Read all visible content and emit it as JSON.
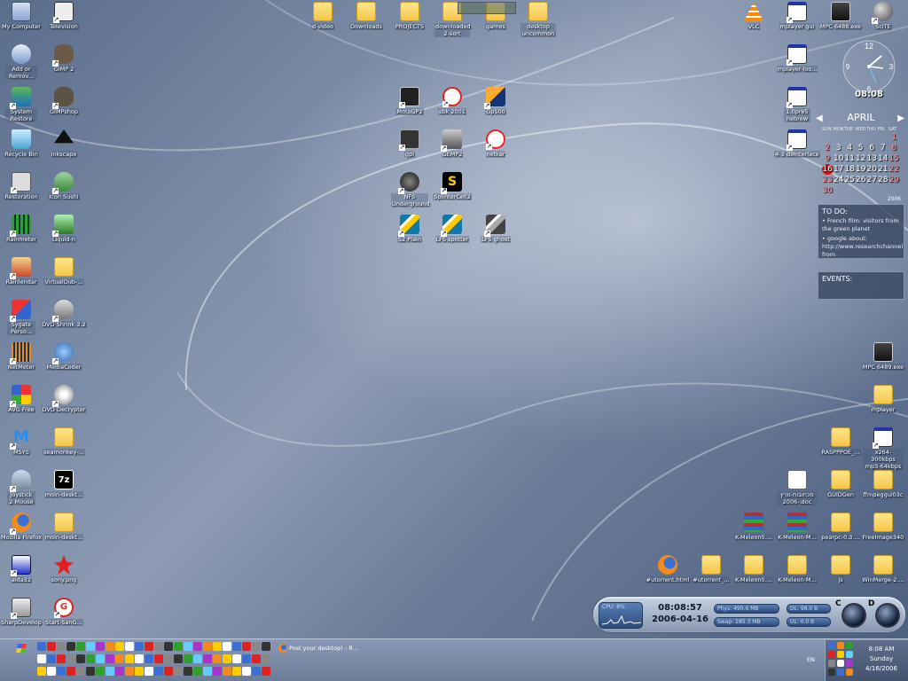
{
  "desktop": {
    "icons": [
      {
        "label": "My Computer",
        "glyph": "computer-icon"
      },
      {
        "label": "Television",
        "glyph": "television-icon"
      },
      {
        "label": "Add or Remov...",
        "glyph": "add-remove-programs-icon"
      },
      {
        "label": "GIMP 2",
        "glyph": "gimp-icon"
      },
      {
        "label": "System Restore",
        "glyph": "system-restore-icon"
      },
      {
        "label": "GIMPshop",
        "glyph": "gimpshop-icon"
      },
      {
        "label": "Recycle Bin",
        "glyph": "recycle-bin-icon"
      },
      {
        "label": "inkscape",
        "glyph": "inkscape-icon"
      },
      {
        "label": "Restoration",
        "glyph": "restoration-icon"
      },
      {
        "label": "Icon Sushi",
        "glyph": "icon-sushi-icon"
      },
      {
        "label": "Rainmeter",
        "glyph": "rainmeter-icon"
      },
      {
        "label": "Liquid-n",
        "glyph": "liquid-n-icon"
      },
      {
        "label": "Rainlendar",
        "glyph": "rainlendar-icon"
      },
      {
        "label": "VirtualDub-...",
        "glyph": "folder-icon"
      },
      {
        "label": "Sygate Perso...",
        "glyph": "sygate-icon"
      },
      {
        "label": "DVD Shrink 3.2",
        "glyph": "dvd-shrink-icon"
      },
      {
        "label": "NetMeter",
        "glyph": "netmeter-icon"
      },
      {
        "label": "MediaCoder",
        "glyph": "mediacoder-icon"
      },
      {
        "label": "AVG Free",
        "glyph": "avg-icon"
      },
      {
        "label": "DVD Decrypter",
        "glyph": "dvd-decrypter-icon"
      },
      {
        "label": "MSYS",
        "glyph": "msys-icon"
      },
      {
        "label": "seamonkey-...",
        "glyph": "folder-icon"
      },
      {
        "label": "Joystick 2 Mouse",
        "glyph": "joystick-icon"
      },
      {
        "label": "moin-deskt...",
        "glyph": "7zip-icon"
      },
      {
        "label": "Mozilla Firefox",
        "glyph": "firefox-icon"
      },
      {
        "label": "moin-deskt...",
        "glyph": "folder-icon"
      },
      {
        "label": "aida32",
        "glyph": "aida32-icon"
      },
      {
        "label": "sony.png",
        "glyph": "image-icon"
      },
      {
        "label": "SharpDevelop",
        "glyph": "sharpdevelop-icon"
      },
      {
        "label": "Start-SanG...",
        "glyph": "start-icon"
      },
      {
        "label": "d-video",
        "glyph": "folder-icon"
      },
      {
        "label": "Downloads",
        "glyph": "folder-icon"
      },
      {
        "label": "PROJECTS",
        "glyph": "folder-icon"
      },
      {
        "label": "downloaded 2-sort",
        "glyph": "folder-icon"
      },
      {
        "label": "games",
        "glyph": "folder-icon"
      },
      {
        "label": "desktop uncommon",
        "glyph": "folder-icon"
      },
      {
        "label": "MotoGP2",
        "glyph": "motogp-icon"
      },
      {
        "label": "sbk 2001",
        "glyph": "sbk-icon"
      },
      {
        "label": "Gp500",
        "glyph": "gp500-icon"
      },
      {
        "label": "gpl",
        "glyph": "gpl-icon"
      },
      {
        "label": "GEMP2",
        "glyph": "gemp-icon"
      },
      {
        "label": "netkar",
        "glyph": "netkar-icon"
      },
      {
        "label": "NFS Underground",
        "glyph": "nfs-icon"
      },
      {
        "label": "SplinterCell2",
        "glyph": "splintercell-icon"
      },
      {
        "label": "S2 Plain",
        "glyph": "lfs-icon"
      },
      {
        "label": "LFS spotter",
        "glyph": "lfs-icon"
      },
      {
        "label": "LFS ghost",
        "glyph": "lfs-icon"
      },
      {
        "label": "VLC",
        "glyph": "vlc-icon"
      },
      {
        "label": "mplayer gui",
        "glyph": "mplayer-icon"
      },
      {
        "label": "MPC 6488.exe",
        "glyph": "mpc-icon"
      },
      {
        "label": "SciTE",
        "glyph": "scite-icon"
      },
      {
        "label": "mplayer-loo...",
        "glyph": "mplayer-icon"
      },
      {
        "label": "1.0pre5 hebrew",
        "glyph": "mplayer-icon"
      },
      {
        "label": "4-3 deinterlace",
        "glyph": "mplayer-icon"
      },
      {
        "label": "MPC 6489.exe",
        "glyph": "mpc-icon"
      },
      {
        "label": "mplayer",
        "glyph": "folder-icon"
      },
      {
        "label": "RASPPPOE_...",
        "glyph": "folder-icon"
      },
      {
        "label": "x264-300kbps mp3-64kbps",
        "glyph": "mplayer-icon"
      },
      {
        "label": "מכתובות-מרץ -2006.doc",
        "glyph": "document-icon"
      },
      {
        "label": "GUIDGen",
        "glyph": "folder-icon"
      },
      {
        "label": "ffmpeggui03c",
        "glyph": "folder-icon"
      },
      {
        "label": "K-Meleon0....",
        "glyph": "winrar-icon"
      },
      {
        "label": "K-Meleon-M...",
        "glyph": "winrar-icon"
      },
      {
        "label": "pearpc-0.3....",
        "glyph": "folder-icon"
      },
      {
        "label": "FreeImage340",
        "glyph": "folder-icon"
      },
      {
        "label": "#utorrent.html",
        "glyph": "firefox-icon"
      },
      {
        "label": "#utorrent_...",
        "glyph": "folder-icon"
      },
      {
        "label": "K-Meleon0....",
        "glyph": "folder-icon"
      },
      {
        "label": "K-Meleon-M...",
        "glyph": "folder-icon"
      },
      {
        "label": "js",
        "glyph": "folder-icon"
      },
      {
        "label": "WinMerge-2....",
        "glyph": "folder-icon"
      }
    ]
  },
  "clock": {
    "time": "08:08"
  },
  "calendar": {
    "month": "APRIL",
    "year": "2006",
    "weekdays": [
      "SUN",
      "MON",
      "TUE",
      "WED",
      "THU",
      "FRI",
      "SAT"
    ],
    "days": [
      "",
      "",
      "",
      "",
      "",
      "",
      "1",
      "2",
      "3",
      "4",
      "5",
      "6",
      "7",
      "8",
      "9",
      "10",
      "11",
      "12",
      "13",
      "14",
      "15",
      "16",
      "17",
      "18",
      "19",
      "20",
      "21",
      "22",
      "23",
      "24",
      "25",
      "26",
      "27",
      "28",
      "29",
      "30"
    ],
    "today": "16",
    "prev_icon": "chevron-left-icon",
    "next_icon": "chevron-right-icon"
  },
  "todo": {
    "title": "TO DO:",
    "items": [
      "French film: visitors from the green planet",
      "google about: http://www.researchchannel from"
    ]
  },
  "events": {
    "title": "EVENTS:"
  },
  "sysmon": {
    "cpu": "CPU: 8%",
    "time": "08:08:57",
    "date": "2006-04-16",
    "phys": "Phys: 490.6 MB",
    "swap": "Swap: 285.3 MB",
    "dl": "DL: 98.0 B",
    "ul": "UL: 0.0 B",
    "drive_c": "C",
    "drive_d": "D"
  },
  "taskbar": {
    "active_task": "Post your desktop! - R...",
    "lang": "EN",
    "tray_time": "8:08 AM",
    "tray_day": "Sunday",
    "tray_date": "4/16/2006"
  },
  "colors": {
    "folder": "#f3c64a",
    "accent": "#6b7c99",
    "today": "#c21a1a"
  }
}
